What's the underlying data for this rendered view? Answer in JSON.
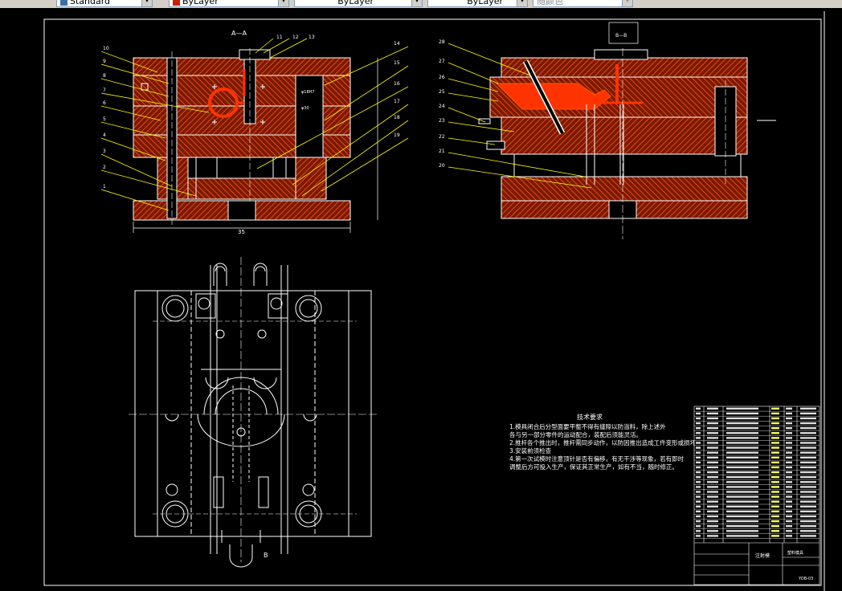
{
  "toolbar": {
    "fields": [
      {
        "value": "Standard",
        "icon": "text-style-icon"
      },
      {
        "value": "ByLayer",
        "icon": "color-swatch-icon",
        "accent": "#cc2200"
      },
      {
        "value": "ByLayer",
        "icon": "linetype-icon"
      },
      {
        "value": "ByLayer",
        "icon": "lineweight-icon"
      },
      {
        "value": "随颜色",
        "icon": "plotstyle-icon"
      }
    ]
  },
  "drawing": {
    "view_labels": {
      "section_aa": "A—A",
      "section_bb": "B—B"
    },
    "left_callouts": [
      "10",
      "9",
      "8",
      "7",
      "6",
      "5",
      "4",
      "3",
      "2",
      "1"
    ],
    "top_callouts": [
      "11",
      "12",
      "13"
    ],
    "right_callouts": [
      "14",
      "15",
      "16",
      "17",
      "18",
      "19"
    ],
    "b_left_callouts": [
      "28",
      "27",
      "26",
      "25",
      "24",
      "23",
      "22",
      "21",
      "20"
    ],
    "dimension_width": "35",
    "bottom_marker": "B",
    "tech_requirements": {
      "title": "技术要求",
      "lines": [
        "1.模具闭合后分型面要平整不得有缝隙以防溢料，除上述外",
        "各与另一部分零件的运动配合，装配后须能灵活。",
        "2.推杆各个推出时，推杆需同步动作，以防因推出造成工件变形或损坏",
        "3.安装前须检查",
        "4.第一次试模时注意顶针是否有偏移，有无干涉等现象，若有即时",
        "调整后方可投入生产，保证其正常生产，如有不当，随时修正。"
      ]
    },
    "title_block": {
      "part_label": "注射模",
      "drawing_no": "YOB-03",
      "sheet_name": "塑料模具"
    }
  },
  "colors": {
    "background": "#000000",
    "outline": "#ffffff",
    "section_fill": "#cc3300",
    "callout": "#ffff00",
    "part_highlight": "#ff3300"
  }
}
